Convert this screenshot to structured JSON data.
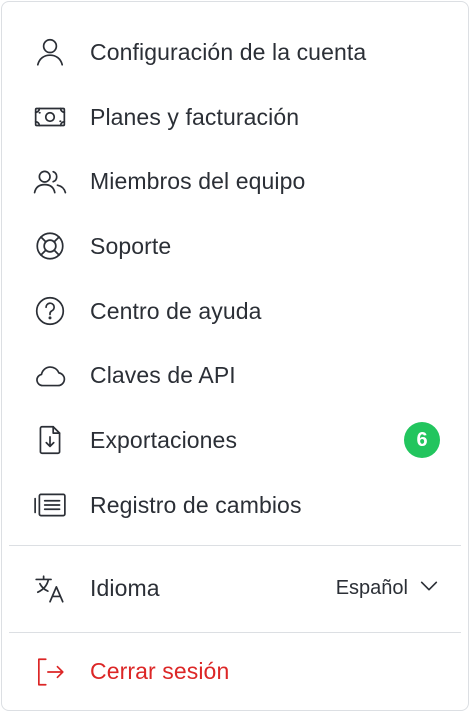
{
  "menu": {
    "items": [
      {
        "label": "Configuración de la cuenta",
        "icon": "user-icon"
      },
      {
        "label": "Planes y facturación",
        "icon": "banknote-icon"
      },
      {
        "label": "Miembros del equipo",
        "icon": "users-icon"
      },
      {
        "label": "Soporte",
        "icon": "lifebuoy-icon"
      },
      {
        "label": "Centro de ayuda",
        "icon": "help-circle-icon"
      },
      {
        "label": "Claves de API",
        "icon": "cloud-icon"
      },
      {
        "label": "Exportaciones",
        "icon": "file-download-icon",
        "badge": "6"
      },
      {
        "label": "Registro de cambios",
        "icon": "changelog-icon"
      }
    ],
    "language": {
      "label": "Idioma",
      "value": "Español",
      "icon": "translate-icon"
    },
    "logout": {
      "label": "Cerrar sesión",
      "icon": "logout-icon"
    }
  },
  "colors": {
    "badge": "#22c55e",
    "danger": "#dc2626",
    "text": "#2b2f36",
    "border": "#dcdfe3"
  }
}
